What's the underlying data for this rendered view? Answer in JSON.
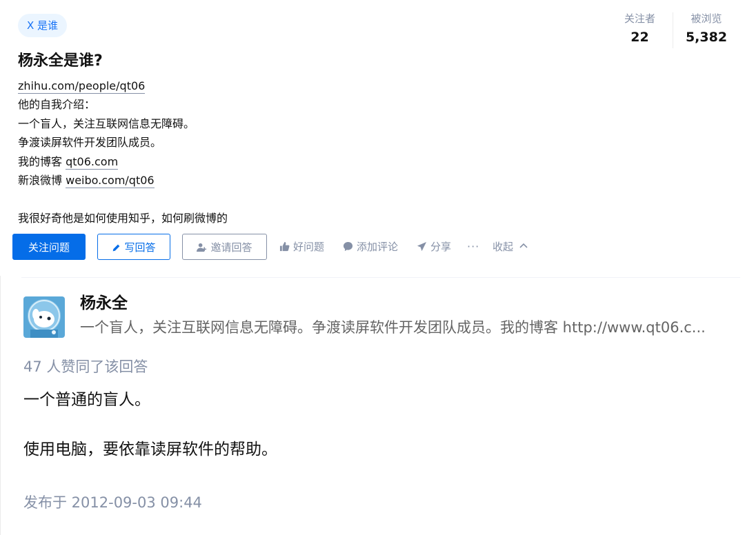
{
  "question": {
    "topic_tag": "X 是谁",
    "stats": {
      "followers_label": "关注者",
      "followers_value": "22",
      "views_label": "被浏览",
      "views_value": "5,382"
    },
    "title": "杨永全是谁?",
    "body": {
      "profile_link": "zhihu.com/people/qt06",
      "intro_heading": "他的自我介绍：",
      "intro_line1": "一个盲人，关注互联网信息无障碍。",
      "intro_line2": "争渡读屏软件开发团队成员。",
      "blog_prefix": "我的博客",
      "blog_link": "qt06.com",
      "weibo_prefix": "新浪微博",
      "weibo_link": "weibo.com/qt06",
      "closing": "我很好奇他是如何使用知乎，如何刷微博的"
    },
    "actions": {
      "follow": "关注问题",
      "write": "写回答",
      "invite": "邀请回答",
      "good_question": "好问题",
      "add_comment": "添加评论",
      "share": "分享",
      "more": "···",
      "fold": "收起"
    }
  },
  "answer": {
    "author_name": "杨永全",
    "author_headline": "一个盲人，关注互联网信息无障碍。争渡读屏软件开发团队成员。我的博客 http://www.qt06.c...",
    "vote_text": "47 人赞同了该回答",
    "paragraphs": [
      "一个普通的盲人。",
      "使用电脑，要依靠读屏软件的帮助。"
    ],
    "published": "发布于 2012-09-03 09:44"
  },
  "colors": {
    "brand_blue": "#056de8",
    "tag_bg": "#ebf5ff",
    "muted_gray": "#8590a6"
  }
}
